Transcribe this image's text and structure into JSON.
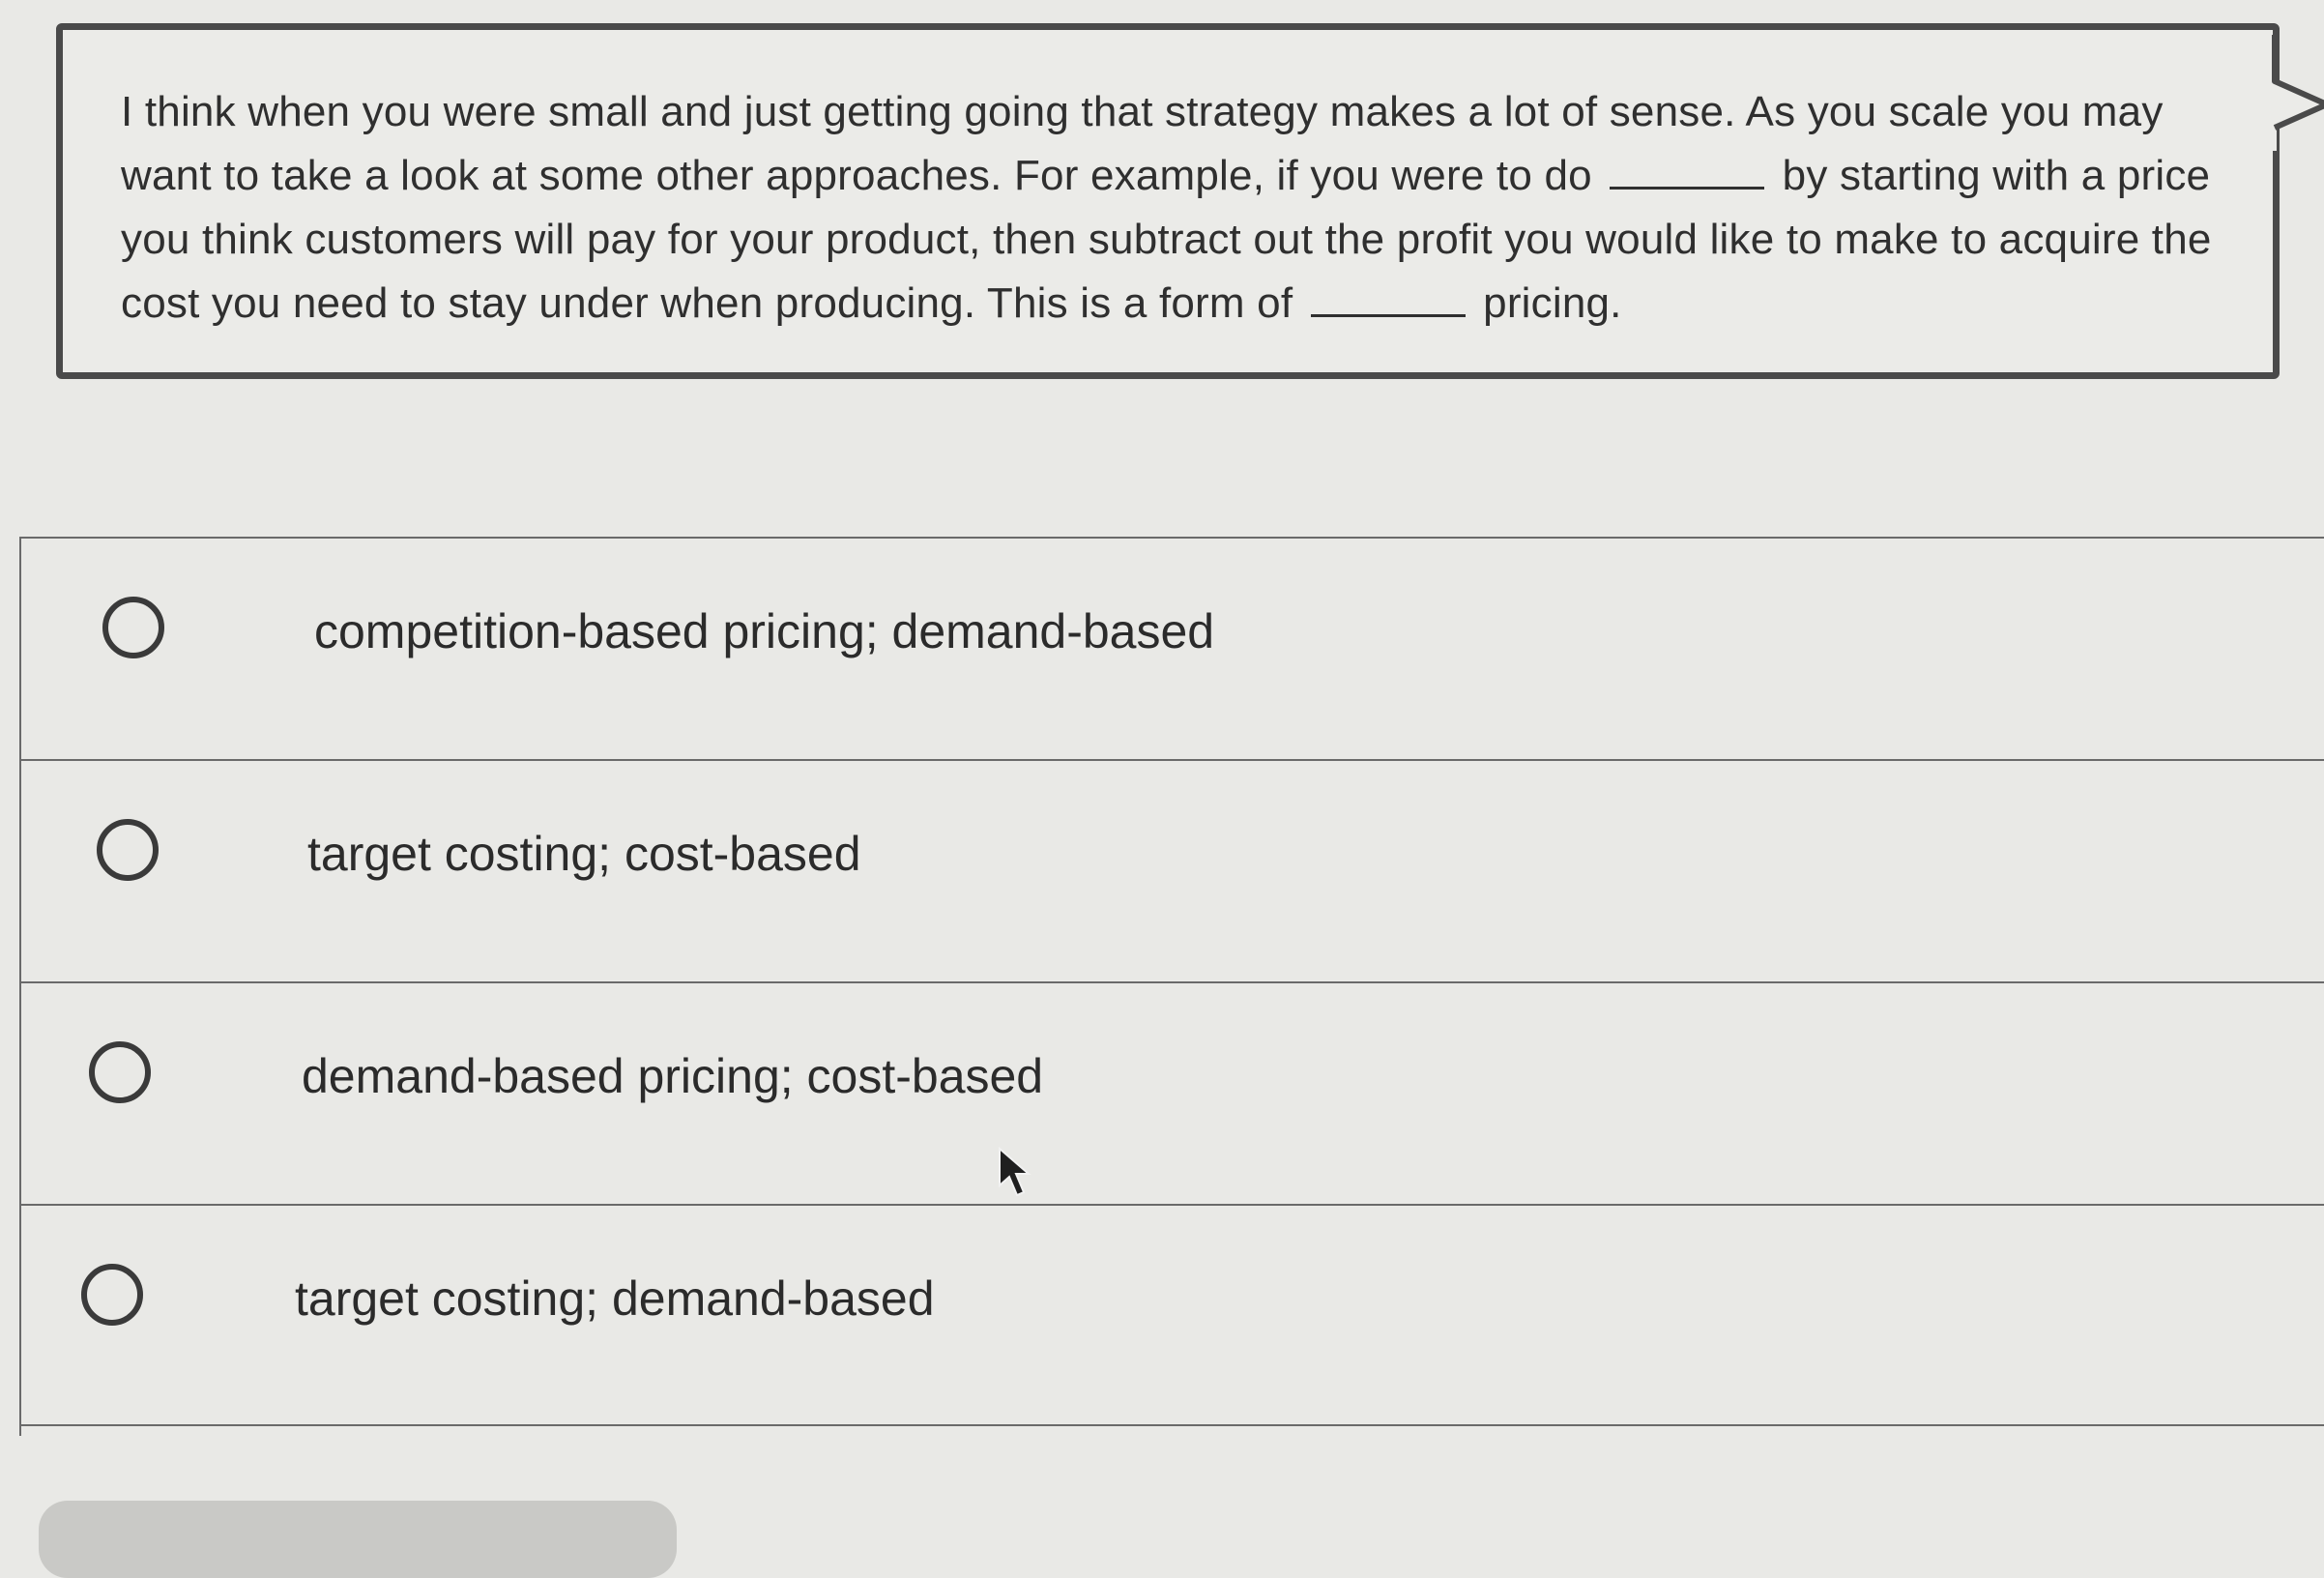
{
  "question": {
    "text_before_blank_1": "I think when you were small and just getting going that strategy makes a lot of sense. As you scale you may want to take a look at some other approaches. For example, if you were to do",
    "text_between_blanks": "by starting with a price you think customers will pay for your product, then subtract out the profit you would like to make to acquire the cost you need to stay under when producing. This is a form of",
    "text_after_blank_2": "pricing."
  },
  "options": [
    {
      "label": "competition-based pricing; demand-based",
      "selected": false
    },
    {
      "label": "target costing; cost-based",
      "selected": false
    },
    {
      "label": "demand-based pricing; cost-based",
      "selected": false
    },
    {
      "label": "target costing; demand-based",
      "selected": false
    }
  ],
  "colors": {
    "background": "#e9e9e6",
    "border": "#4a4a4a",
    "text": "#2b2b2b"
  },
  "icons": {
    "radio": "radio-unchecked-icon",
    "pointer": "mouse-pointer-icon"
  }
}
